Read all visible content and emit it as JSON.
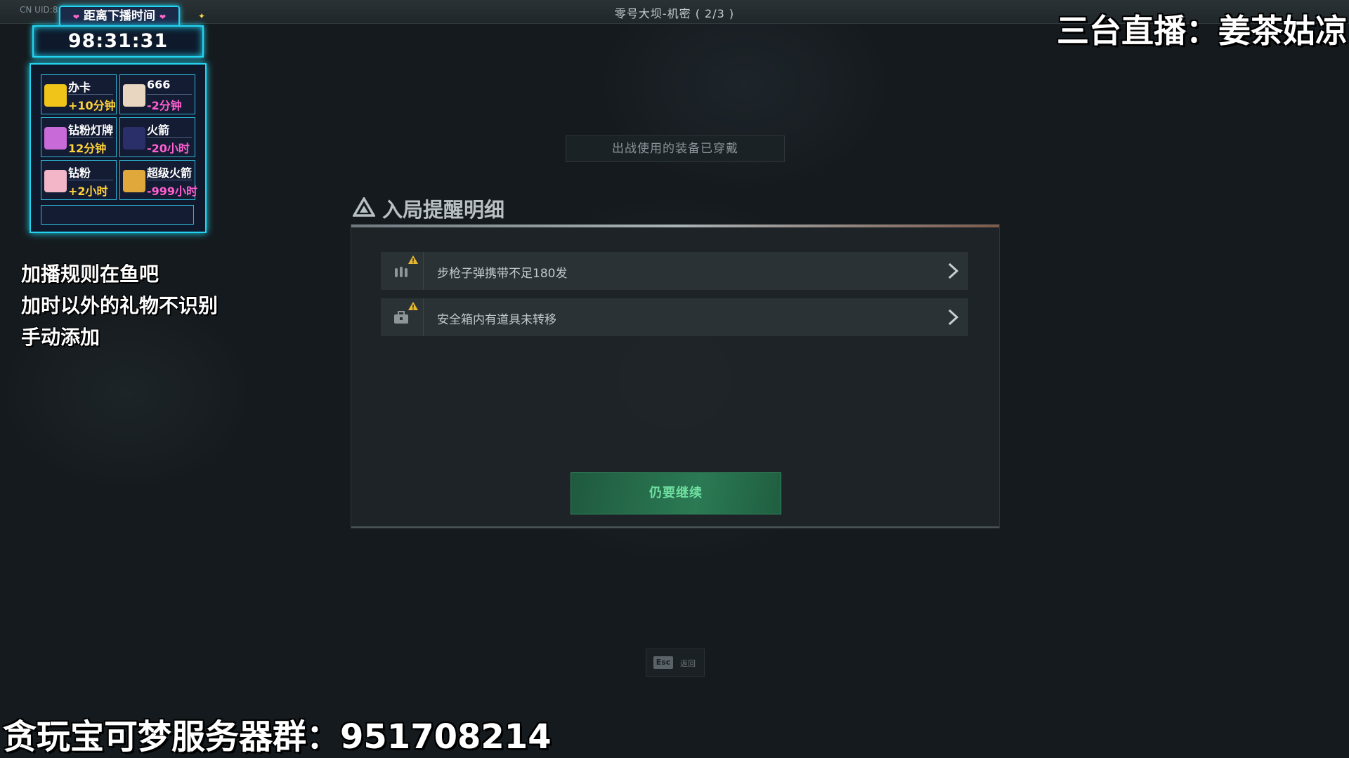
{
  "header": {
    "uid": "CN UID:8",
    "title": "零号大坝-机密 ( 2/3 )"
  },
  "stream_overlay": {
    "streamer_tag": "三台直播：姜茶姑凉",
    "timer": {
      "title": "距离下播时间",
      "time": "98:31:31"
    },
    "gifts": [
      {
        "name": "办卡",
        "effect": "+10分钟",
        "type": "plus",
        "thumb_color": "#f0c419"
      },
      {
        "name": "666",
        "effect": "-2分钟",
        "type": "minus",
        "thumb_color": "#e8d6c0"
      },
      {
        "name": "钻粉灯牌",
        "effect": "12分钟",
        "type": "plus",
        "thumb_color": "#c86ad8"
      },
      {
        "name": "火箭",
        "effect": "-20小时",
        "type": "minus",
        "thumb_color": "#2a2f6a"
      },
      {
        "name": "钻粉",
        "effect": "+2小时",
        "type": "plus",
        "thumb_color": "#f2b6c8"
      },
      {
        "name": "超级火箭",
        "effect": "-999小时",
        "type": "minus",
        "thumb_color": "#e0a83a"
      }
    ],
    "rules": [
      "加播规则在鱼吧",
      "加时以外的礼物不识别",
      "手动添加"
    ],
    "bottom_banner": "贪玩宝可梦服务器群：951708214"
  },
  "notice": {
    "equipped": "出战使用的装备已穿戴"
  },
  "dialog": {
    "title": "入局提醒明细",
    "items": [
      {
        "text": "步枪子弹携带不足180发",
        "icon": "ammo-icon"
      },
      {
        "text": "安全箱内有道具未转移",
        "icon": "safe-box-icon"
      }
    ],
    "continue_label": "仍要继续"
  },
  "footer": {
    "esc_key": "Esc",
    "esc_label": "返回"
  },
  "colors": {
    "accent_cyan": "#22d4f0",
    "accent_pink": "#ff5fd0",
    "accent_gold": "#ffd23a",
    "continue_green": "#2b7a54",
    "warning_yellow": "#e8b830"
  }
}
